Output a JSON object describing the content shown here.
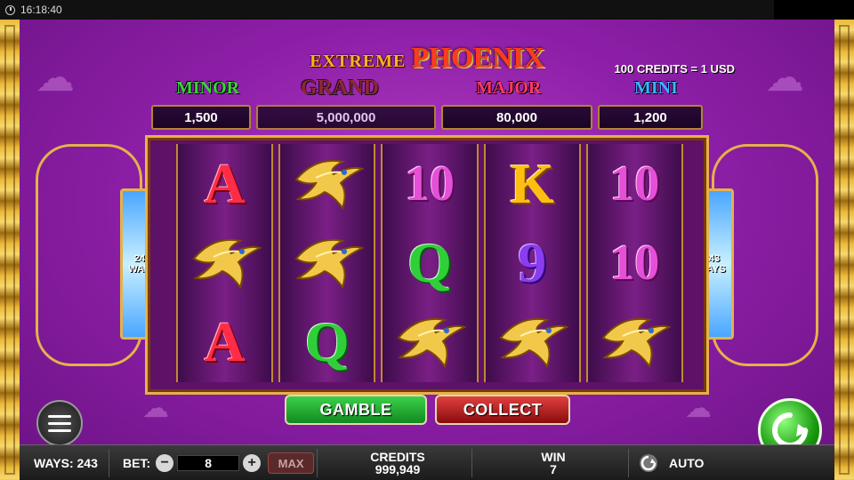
{
  "status_bar": {
    "time": "16:18:40"
  },
  "title": {
    "line1": "EXTREME",
    "line2": "PHOENIX"
  },
  "denomination": "100 CREDITS = 1 USD",
  "jackpots": {
    "minor": {
      "label": "MINOR",
      "value": "1,500"
    },
    "grand": {
      "label": "GRAND",
      "value": "5,000,000"
    },
    "major": {
      "label": "MAJOR",
      "value": "80,000"
    },
    "mini": {
      "label": "MINI",
      "value": "1,200"
    }
  },
  "ways_panel": {
    "count": "243",
    "label": "WAYS"
  },
  "reels": [
    [
      "A",
      "phoenix",
      "A"
    ],
    [
      "phoenix",
      "phoenix",
      "Q"
    ],
    [
      "10",
      "Q",
      "phoenix"
    ],
    [
      "K",
      "9",
      "phoenix"
    ],
    [
      "10",
      "10",
      "phoenix"
    ]
  ],
  "buttons": {
    "gamble": "GAMBLE",
    "collect": "COLLECT"
  },
  "bottom_bar": {
    "ways_label": "WAYS:",
    "ways_value": "243",
    "bet_label": "BET:",
    "bet_minus": "−",
    "bet_value": "8",
    "bet_plus": "+",
    "max_label": "MAX",
    "credits_label": "CREDITS",
    "credits_value": "999,949",
    "win_label": "WIN",
    "win_value": "7",
    "auto_label": "AUTO"
  },
  "colors": {
    "background": "#8e1fa8",
    "gold_frame": "#e4b24a",
    "gamble_button": "#22a833",
    "collect_button": "#c02020",
    "spin_button": "#2fb81f"
  },
  "icons": {
    "clock": "clock-icon",
    "menu": "hamburger-icon",
    "spin": "circular-arrow-icon",
    "auto": "auto-spin-icon"
  }
}
